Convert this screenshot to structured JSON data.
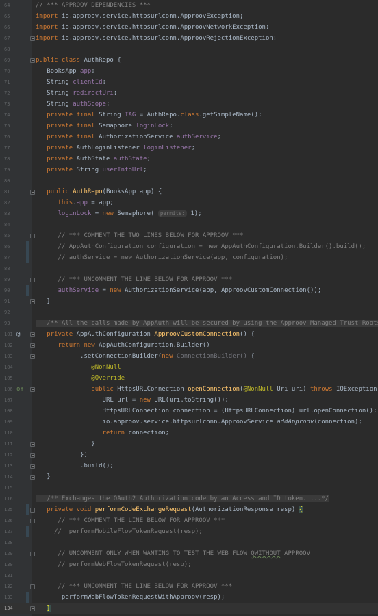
{
  "editor": {
    "current_line": "134",
    "lines": [
      {
        "n": "64",
        "fold": false,
        "t": [
          [
            "c",
            "// *** APPROOV DEPENDENCIES ***"
          ]
        ]
      },
      {
        "n": "65",
        "fold": false,
        "t": [
          [
            "k",
            "import "
          ],
          [
            "p",
            "io.approov.service.httpsurlconn.ApproovException;"
          ]
        ]
      },
      {
        "n": "66",
        "fold": false,
        "t": [
          [
            "k",
            "import "
          ],
          [
            "p",
            "io.approov.service.httpsurlconn.ApproovNetworkException;"
          ]
        ]
      },
      {
        "n": "67",
        "fold": true,
        "t": [
          [
            "k",
            "import "
          ],
          [
            "p",
            "io.approov.service.httpsurlconn.ApproovRejectionException;"
          ]
        ]
      },
      {
        "n": "68",
        "fold": false,
        "t": []
      },
      {
        "n": "69",
        "fold": true,
        "t": [
          [
            "k",
            "public class "
          ],
          [
            "p",
            "AuthRepo {"
          ]
        ]
      },
      {
        "n": "70",
        "fold": false,
        "t": [
          [
            "p",
            "   BooksApp "
          ],
          [
            "f",
            "app"
          ],
          [
            "p",
            ";"
          ]
        ]
      },
      {
        "n": "71",
        "fold": false,
        "t": [
          [
            "p",
            "   String "
          ],
          [
            "f",
            "clientId"
          ],
          [
            "p",
            ";"
          ]
        ]
      },
      {
        "n": "72",
        "fold": false,
        "t": [
          [
            "p",
            "   String "
          ],
          [
            "f",
            "redirectUri"
          ],
          [
            "p",
            ";"
          ]
        ]
      },
      {
        "n": "73",
        "fold": false,
        "t": [
          [
            "p",
            "   String "
          ],
          [
            "f",
            "authScope"
          ],
          [
            "p",
            ";"
          ]
        ]
      },
      {
        "n": "74",
        "fold": false,
        "t": [
          [
            "k",
            "   private final "
          ],
          [
            "p",
            "String "
          ],
          [
            "f",
            "TAG"
          ],
          [
            "p",
            " = AuthRepo."
          ],
          [
            "k",
            "class"
          ],
          [
            "p",
            ".getSimpleName();"
          ]
        ]
      },
      {
        "n": "75",
        "fold": false,
        "t": [
          [
            "k",
            "   private final "
          ],
          [
            "p",
            "Semaphore "
          ],
          [
            "f",
            "loginLock"
          ],
          [
            "p",
            ";"
          ]
        ]
      },
      {
        "n": "76",
        "fold": false,
        "t": [
          [
            "k",
            "   private final "
          ],
          [
            "p",
            "AuthorizationService "
          ],
          [
            "f",
            "authService"
          ],
          [
            "p",
            ";"
          ]
        ]
      },
      {
        "n": "77",
        "fold": false,
        "t": [
          [
            "k",
            "   private "
          ],
          [
            "p",
            "AuthLoginListener "
          ],
          [
            "f",
            "loginListener"
          ],
          [
            "p",
            ";"
          ]
        ]
      },
      {
        "n": "78",
        "fold": false,
        "t": [
          [
            "k",
            "   private "
          ],
          [
            "p",
            "AuthState "
          ],
          [
            "f",
            "authState"
          ],
          [
            "p",
            ";"
          ]
        ]
      },
      {
        "n": "79",
        "fold": false,
        "t": [
          [
            "k",
            "   private "
          ],
          [
            "p",
            "String "
          ],
          [
            "f",
            "userInfoUrl"
          ],
          [
            "p",
            ";"
          ]
        ]
      },
      {
        "n": "80",
        "fold": false,
        "t": []
      },
      {
        "n": "81",
        "fold": true,
        "t": [
          [
            "k",
            "   public "
          ],
          [
            "fn",
            "AuthRepo"
          ],
          [
            "p",
            "(BooksApp app) {"
          ]
        ]
      },
      {
        "n": "82",
        "fold": false,
        "t": [
          [
            "k",
            "      this"
          ],
          [
            "p",
            "."
          ],
          [
            "f",
            "app"
          ],
          [
            "p",
            " = app;"
          ]
        ]
      },
      {
        "n": "83",
        "fold": false,
        "t": [
          [
            "f",
            "      loginLock"
          ],
          [
            "p",
            " = "
          ],
          [
            "k",
            "new "
          ],
          [
            "p",
            "Semaphore( "
          ],
          [
            "h",
            "permits:"
          ],
          [
            "p",
            " 1);"
          ]
        ]
      },
      {
        "n": "84",
        "fold": false,
        "t": []
      },
      {
        "n": "85",
        "fold": true,
        "t": [
          [
            "c",
            "      // *** COMMENT THE TWO LINES BELOW FOR APPROOV ***"
          ]
        ]
      },
      {
        "n": "86",
        "fold": false,
        "chg": true,
        "t": [
          [
            "c",
            "      // AppAuthConfiguration configuration = new AppAuthConfiguration.Builder().build();"
          ]
        ]
      },
      {
        "n": "87",
        "fold": false,
        "chg": true,
        "t": [
          [
            "c",
            "      // authService = new AuthorizationService(app, configuration);"
          ]
        ]
      },
      {
        "n": "88",
        "fold": false,
        "t": []
      },
      {
        "n": "89",
        "fold": true,
        "t": [
          [
            "c",
            "      // *** UNCOMMENT THE LINE BELOW FOR APPROOV ***"
          ]
        ]
      },
      {
        "n": "90",
        "fold": false,
        "chg": true,
        "t": [
          [
            "f",
            "      authService"
          ],
          [
            "p",
            " = "
          ],
          [
            "k",
            "new "
          ],
          [
            "p",
            "AuthorizationService(app, ApproovCustomConnection());"
          ]
        ]
      },
      {
        "n": "91",
        "fold": true,
        "t": [
          [
            "p",
            "   }"
          ]
        ]
      },
      {
        "n": "92",
        "fold": false,
        "t": []
      },
      {
        "n": "93",
        "fold": false,
        "t": [
          [
            "z",
            "   /** All the calls made by AppAuth will be secured by using the Approov Managed Trust Roots ...*/"
          ]
        ]
      },
      {
        "n": "101",
        "fold": true,
        "icon": "@",
        "t": [
          [
            "k",
            "   private "
          ],
          [
            "p",
            "AppAuthConfiguration "
          ],
          [
            "fn",
            "ApproovCustomConnection"
          ],
          [
            "p",
            "() {"
          ]
        ]
      },
      {
        "n": "102",
        "fold": true,
        "t": [
          [
            "k",
            "      return new "
          ],
          [
            "p",
            "AppAuthConfiguration.Builder()"
          ]
        ]
      },
      {
        "n": "103",
        "fold": true,
        "t": [
          [
            "p",
            "            .setConnectionBuilder("
          ],
          [
            "k",
            "new "
          ],
          [
            "d",
            "ConnectionBuilder() "
          ],
          [
            "p",
            "{"
          ]
        ]
      },
      {
        "n": "104",
        "fold": false,
        "t": [
          [
            "a",
            "               @NonNull"
          ]
        ]
      },
      {
        "n": "105",
        "fold": false,
        "t": [
          [
            "a",
            "               @Override"
          ]
        ]
      },
      {
        "n": "106",
        "fold": true,
        "icon": "o↑",
        "t": [
          [
            "k",
            "               public "
          ],
          [
            "p",
            "HttpsURLConnection "
          ],
          [
            "fn",
            "openConnection"
          ],
          [
            "p",
            "("
          ],
          [
            "a",
            "@NonNull "
          ],
          [
            "p",
            "Uri uri) "
          ],
          [
            "k",
            "throws "
          ],
          [
            "p",
            "IOException {"
          ]
        ]
      },
      {
        "n": "107",
        "fold": false,
        "t": [
          [
            "p",
            "                  URL url = "
          ],
          [
            "k",
            "new "
          ],
          [
            "p",
            "URL(uri.toString());"
          ]
        ]
      },
      {
        "n": "108",
        "fold": false,
        "t": [
          [
            "p",
            "                  HttpsURLConnection connection = (HttpsURLConnection) url.openConnection();"
          ]
        ]
      },
      {
        "n": "109",
        "fold": false,
        "t": [
          [
            "p",
            "                  io.approov.service.httpsurlconn.ApproovService."
          ],
          [
            "i",
            "addApproov"
          ],
          [
            "p",
            "(connection);"
          ]
        ]
      },
      {
        "n": "110",
        "fold": false,
        "t": [
          [
            "k",
            "                  return "
          ],
          [
            "p",
            "connection;"
          ]
        ]
      },
      {
        "n": "111",
        "fold": true,
        "t": [
          [
            "p",
            "               }"
          ]
        ]
      },
      {
        "n": "112",
        "fold": true,
        "t": [
          [
            "p",
            "            })"
          ]
        ]
      },
      {
        "n": "113",
        "fold": true,
        "t": [
          [
            "p",
            "            .build();"
          ]
        ]
      },
      {
        "n": "114",
        "fold": true,
        "t": [
          [
            "p",
            "   }"
          ]
        ]
      },
      {
        "n": "115",
        "fold": false,
        "t": []
      },
      {
        "n": "116",
        "fold": false,
        "t": [
          [
            "z",
            "   /** Exchanges the OAuth2 Authorization code by an Access and ID token. ...*/"
          ]
        ]
      },
      {
        "n": "125",
        "fold": true,
        "chg": true,
        "t": [
          [
            "k",
            "   private void "
          ],
          [
            "fn",
            "performCodeExchangeRequest"
          ],
          [
            "p",
            "(AuthorizationResponse resp) "
          ],
          [
            "b",
            "{"
          ]
        ]
      },
      {
        "n": "126",
        "fold": true,
        "t": [
          [
            "c",
            "      // *** COMMENT THE LINE BELOW FOR APPROOV ***"
          ]
        ]
      },
      {
        "n": "127",
        "fold": false,
        "chg": true,
        "t": [
          [
            "c",
            "     //  performMobileFlowTokenRequest(resp);"
          ]
        ]
      },
      {
        "n": "128",
        "fold": false,
        "t": []
      },
      {
        "n": "129",
        "fold": true,
        "t": [
          [
            "c",
            "      // UNCOMMENT ONLY WHEN WANTING TO TEST THE WEB FLOW "
          ],
          [
            "w",
            "QWITHOUT"
          ],
          [
            "c",
            " APPROOV"
          ]
        ]
      },
      {
        "n": "130",
        "fold": false,
        "t": [
          [
            "c",
            "      // performWebFlowTokenRequest(resp);"
          ]
        ]
      },
      {
        "n": "131",
        "fold": false,
        "t": []
      },
      {
        "n": "132",
        "fold": true,
        "t": [
          [
            "c",
            "      // *** UNCOMMENT THE LINE BELOW FOR APPROOV ***"
          ]
        ]
      },
      {
        "n": "133",
        "fold": false,
        "chg": true,
        "t": [
          [
            "p",
            "       performWebFlowTokenRequestWithApproov(resp);"
          ]
        ]
      },
      {
        "n": "134",
        "fold": true,
        "t": [
          [
            "p",
            "   "
          ],
          [
            "b",
            "}"
          ]
        ]
      }
    ]
  }
}
